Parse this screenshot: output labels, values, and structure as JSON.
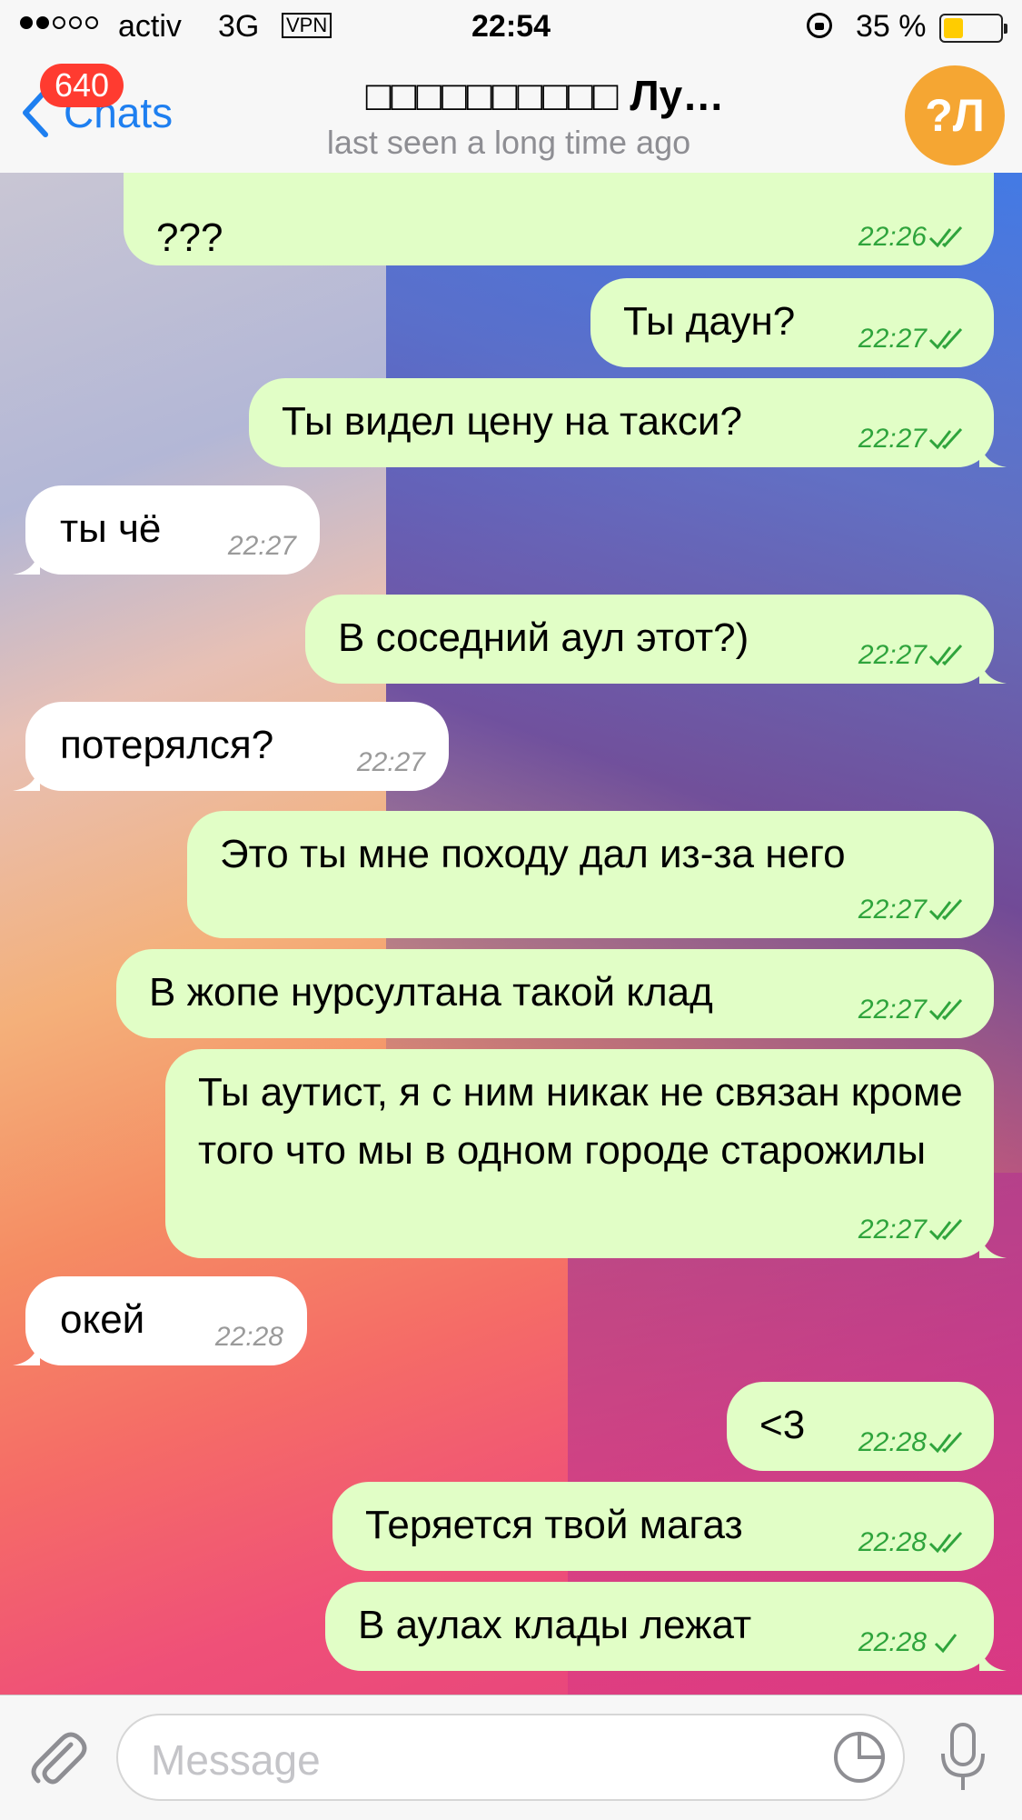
{
  "status_bar": {
    "carrier": "activ",
    "network": "3G",
    "vpn": "VPN",
    "time": "22:54",
    "battery_percent": "35 %",
    "battery_level": 0.35,
    "signal_bars_filled": 2,
    "signal_bars_total": 5
  },
  "nav": {
    "back_label": "Chats",
    "unread_badge": "640",
    "title": "□□□□□□□□□□ Лу…",
    "subtitle": "last seen a long time ago",
    "avatar_initials": "?Л"
  },
  "messages": [
    {
      "dir": "out",
      "text": "???",
      "time": "22:26",
      "read": true
    },
    {
      "dir": "out",
      "text": "Ты даун?",
      "time": "22:27",
      "read": true
    },
    {
      "dir": "out",
      "text": "Ты видел цену на такси?",
      "time": "22:27",
      "read": true
    },
    {
      "dir": "in",
      "text": "ты чё",
      "time": "22:27"
    },
    {
      "dir": "out",
      "text": "В соседний аул этот?)",
      "time": "22:27",
      "read": true
    },
    {
      "dir": "in",
      "text": "потерялся?",
      "time": "22:27"
    },
    {
      "dir": "out",
      "text": "Это ты мне походу дал из-за него",
      "time": "22:27",
      "read": true
    },
    {
      "dir": "out",
      "text": "В жопе нурсултана такой клад",
      "time": "22:27",
      "read": true
    },
    {
      "dir": "out",
      "text": "Ты аутист, я с ним никак не связан кроме того что мы в одном городе старожилы",
      "time": "22:27",
      "read": true
    },
    {
      "dir": "in",
      "text": "окей",
      "time": "22:28"
    },
    {
      "dir": "out",
      "text": "<3",
      "time": "22:28",
      "read": true
    },
    {
      "dir": "out",
      "text": "Теряется твой магаз",
      "time": "22:28",
      "read": true
    },
    {
      "dir": "out",
      "text": "В аулах клады лежат",
      "time": "22:28",
      "read": false
    }
  ],
  "input": {
    "placeholder": "Message"
  },
  "colors": {
    "outgoing_bubble": "#e1fec6",
    "incoming_bubble": "#ffffff",
    "accent": "#1e7ff0",
    "badge": "#ff3b30",
    "avatar": "#f5a633",
    "check": "#2fa43c"
  }
}
